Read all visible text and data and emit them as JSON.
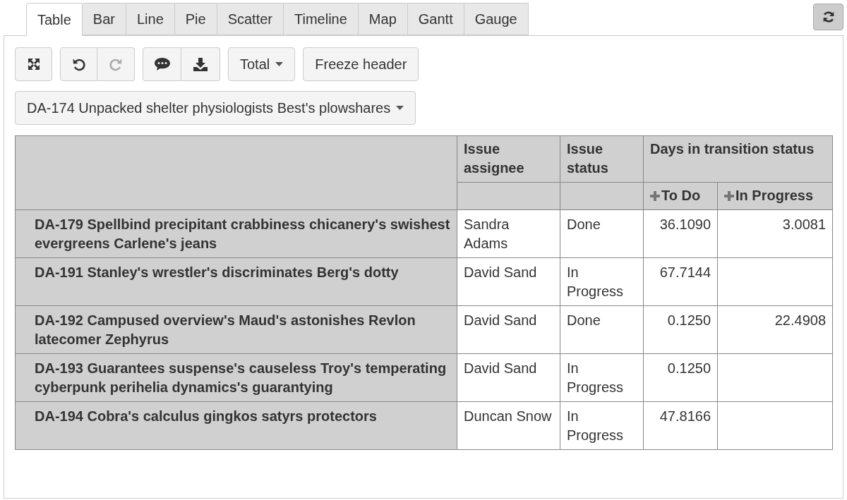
{
  "tabs": [
    {
      "label": "Table",
      "selected": true
    },
    {
      "label": "Bar",
      "selected": false
    },
    {
      "label": "Line",
      "selected": false
    },
    {
      "label": "Pie",
      "selected": false
    },
    {
      "label": "Scatter",
      "selected": false
    },
    {
      "label": "Timeline",
      "selected": false
    },
    {
      "label": "Map",
      "selected": false
    },
    {
      "label": "Gantt",
      "selected": false
    },
    {
      "label": "Gauge",
      "selected": false
    }
  ],
  "toolbar": {
    "undo": {
      "disabled": false
    },
    "redo": {
      "disabled": true
    },
    "aggregate": "Total",
    "freeze": "Freeze header"
  },
  "issue_selector": "DA-174 Unpacked shelter physiologists Best's plowshares",
  "table": {
    "columns": [
      "Issue assignee",
      "Issue status",
      "Days in transition status"
    ],
    "subcolumns": [
      "To Do",
      "In Progress"
    ],
    "rows": [
      {
        "issue": "DA-179 Spellbind precipitant crabbiness chicanery's swishest evergreens Carlene's jeans",
        "assignee": "Sandra Adams",
        "status": "Done",
        "to_do": "36.1090",
        "in_progress": "3.0081"
      },
      {
        "issue": "DA-191 Stanley's wrestler's discriminates Berg's dotty",
        "assignee": "David Sand",
        "status": "In Progress",
        "to_do": "67.7144"
      },
      {
        "issue": "DA-192 Campused overview's Maud's astonishes Revlon latecomer Zephyrus",
        "assignee": "David Sand",
        "status": "Done",
        "to_do": "0.1250",
        "in_progress": "22.4908"
      },
      {
        "issue": "DA-193 Guarantees suspense's causeless Troy's temperating cyberpunk perihelia dynamics's guarantying",
        "assignee": "David Sand",
        "status": "In Progress",
        "to_do": "0.1250"
      },
      {
        "issue": "DA-194 Cobra's calculus gingkos satyrs protectors",
        "assignee": "Duncan Snow",
        "status": "In Progress",
        "to_do": "47.8166"
      }
    ]
  }
}
